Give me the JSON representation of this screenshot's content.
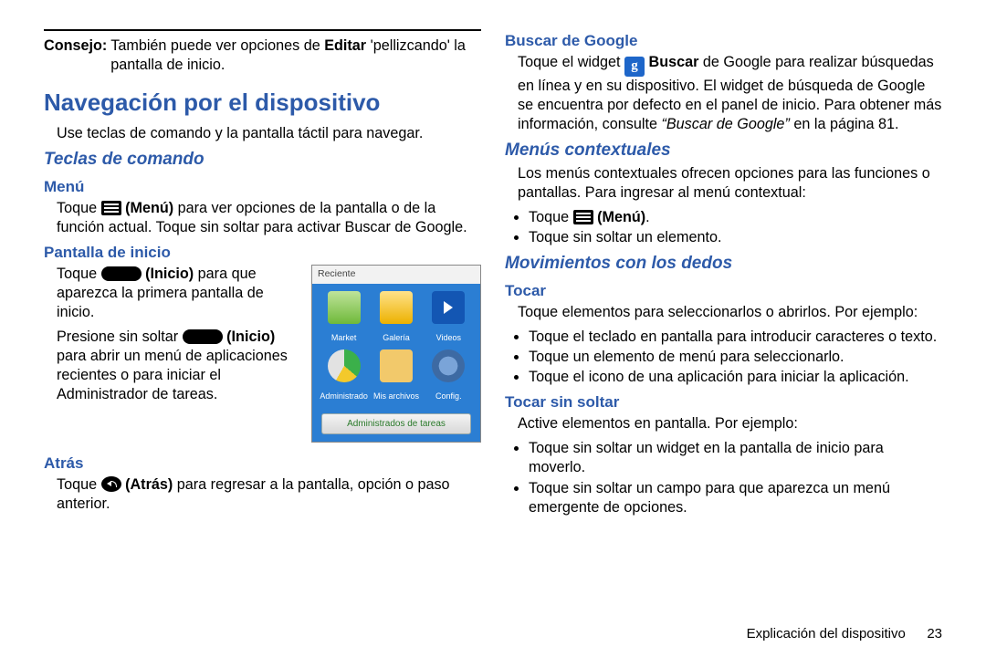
{
  "consejo": {
    "label": "Consejo:",
    "text_a": "También puede ver opciones de ",
    "editar": "Editar",
    "text_b": " 'pellizcando' la pantalla de inicio."
  },
  "nav": {
    "h1": "Navegación por el dispositivo",
    "intro": "Use teclas de comando y la pantalla táctil para navegar."
  },
  "teclas": {
    "h2": "Teclas de comando",
    "menu": {
      "h3": "Menú",
      "p_a": "Toque ",
      "p_b": " (Menú)",
      "p_c": " para ver opciones de la pantalla o de la función actual. Toque sin soltar para activar Buscar de Google."
    },
    "inicio": {
      "h3": "Pantalla de inicio",
      "p1_a": "Toque ",
      "p1_b": " (Inicio)",
      "p1_c": " para que aparezca la primera pantalla de inicio.",
      "p2_a": "Presione sin soltar ",
      "p2_b": "(Inicio)",
      "p2_c": " para abrir un menú de aplicaciones recientes o para iniciar el Administrador de tareas."
    },
    "atras": {
      "h3": "Atrás",
      "p_a": "Toque ",
      "p_b": " (Atrás)",
      "p_c": " para regresar a la pantalla, opción o paso anterior."
    }
  },
  "recent": {
    "head": "Reciente",
    "labels": [
      "Market",
      "Galería",
      "Videos",
      "Administrado",
      "Mis archivos",
      "Config."
    ],
    "button": "Administrados de tareas"
  },
  "google": {
    "h3": "Buscar de Google",
    "g": "g",
    "p_a": "Toque el widget ",
    "p_b": " Buscar",
    "p_c": " de Google para realizar búsquedas en línea y en su dispositivo. El widget de búsqueda de Google se encuentra por defecto en el panel de inicio. Para obtener más información, consulte ",
    "p_ref": "“Buscar de Google”",
    "p_d": " en la página 81."
  },
  "menus": {
    "h2": "Menús contextuales",
    "p": "Los menús contextuales ofrecen opciones para las funciones o pantallas. Para ingresar al menú contextual:",
    "li1_a": "Toque ",
    "li1_b": " (Menú)",
    "li1_c": ".",
    "li2": "Toque sin soltar un elemento."
  },
  "mov": {
    "h2": "Movimientos con los dedos",
    "tocar": {
      "h3": "Tocar",
      "p": "Toque elementos para seleccionarlos o abrirlos. Por ejemplo:",
      "li1": "Toque el teclado en pantalla para introducir caracteres o texto.",
      "li2": "Toque un elemento de menú para seleccionarlo.",
      "li3": "Toque el icono de una aplicación para iniciar la aplicación."
    },
    "tocarsin": {
      "h3": "Tocar sin soltar",
      "p": "Active elementos en pantalla. Por ejemplo:",
      "li1": "Toque sin soltar un widget en la pantalla de inicio para moverlo.",
      "li2": "Toque sin soltar un campo para que aparezca un menú emergente de opciones."
    }
  },
  "footer": {
    "chapter": "Explicación del dispositivo",
    "page": "23"
  }
}
